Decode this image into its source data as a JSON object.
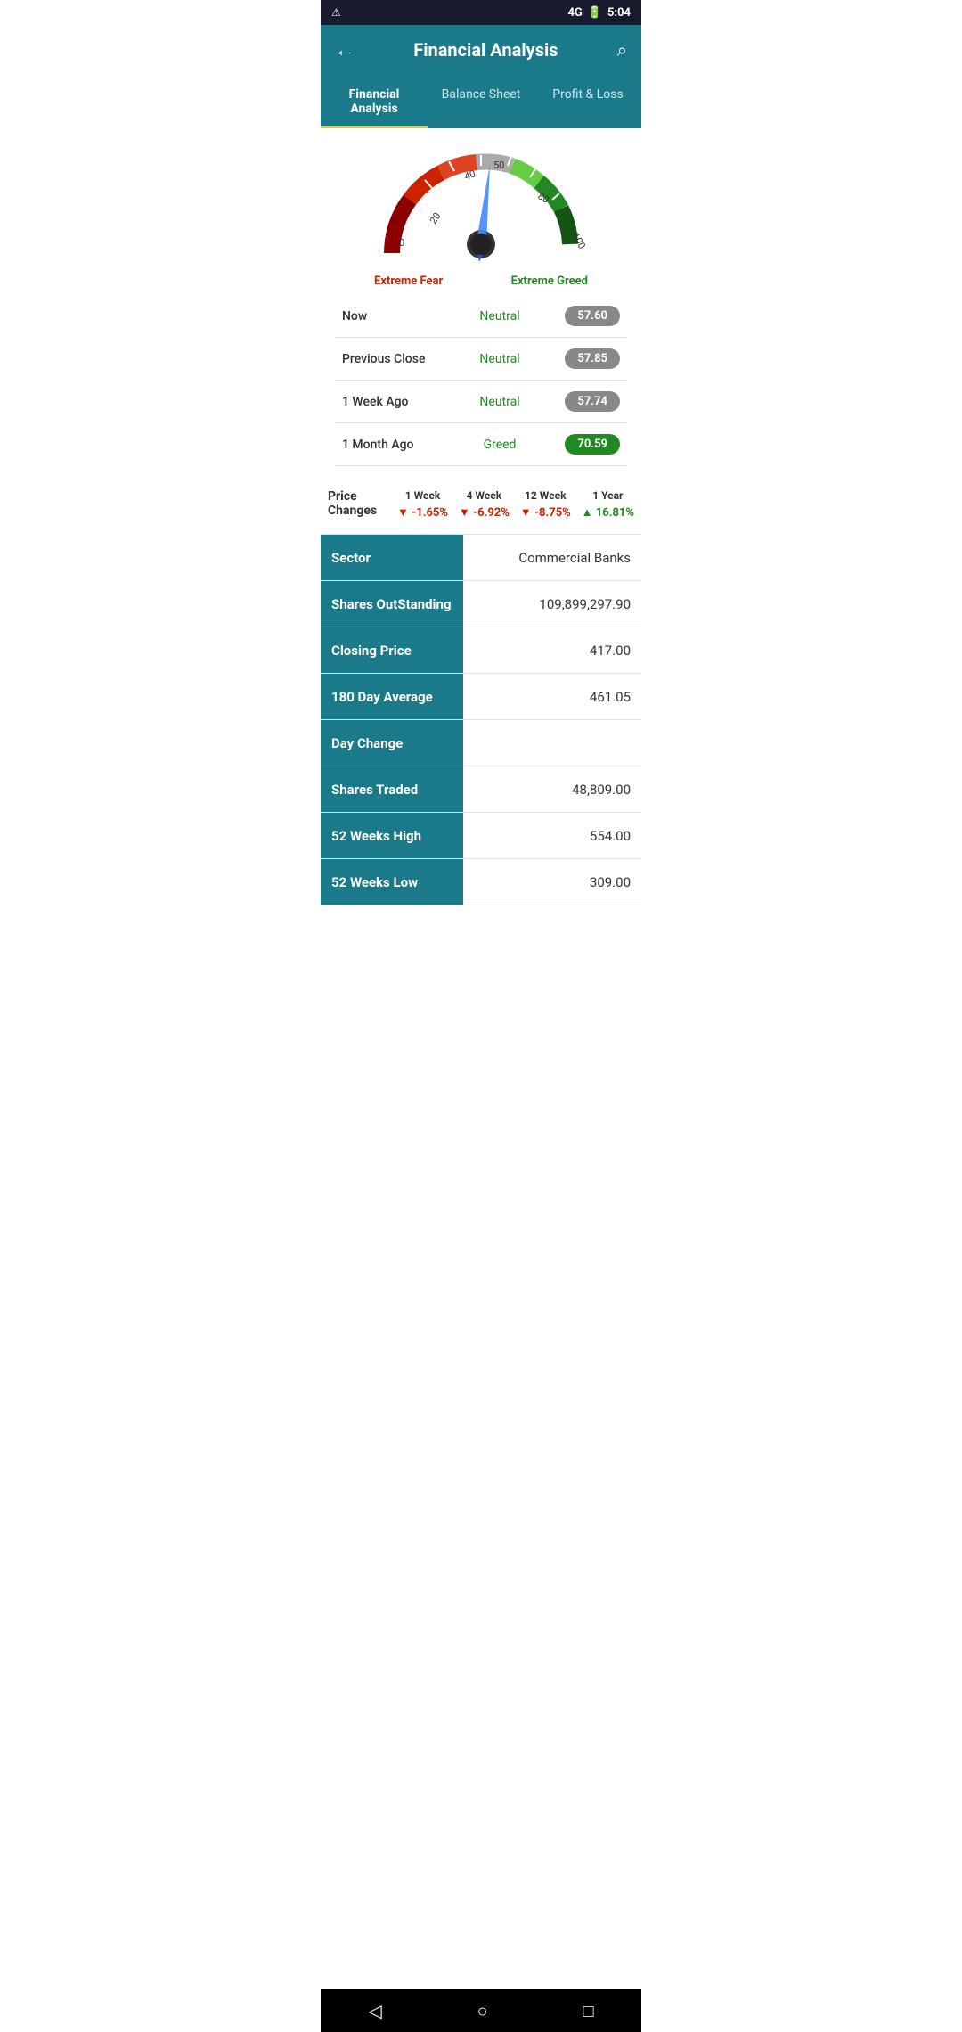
{
  "statusBar": {
    "leftIcon": "⚠",
    "signal": "4G",
    "battery": "⚡",
    "time": "5:04"
  },
  "header": {
    "backIcon": "←",
    "title": "Financial Analysis",
    "searchIcon": "🔍"
  },
  "tabs": [
    {
      "id": "financial-analysis",
      "label": "Financial Analysis",
      "active": true
    },
    {
      "id": "balance-sheet",
      "label": "Balance Sheet",
      "active": false
    },
    {
      "id": "profit-loss",
      "label": "Profit & Loss",
      "active": false
    }
  ],
  "gauge": {
    "extremeFearLabel": "Extreme Fear",
    "extremeGreedLabel": "Extreme Greed"
  },
  "fearGreedRows": [
    {
      "period": "Now",
      "sentiment": "Neutral",
      "value": "57.60",
      "green": false
    },
    {
      "period": "Previous Close",
      "sentiment": "Neutral",
      "value": "57.85",
      "green": false
    },
    {
      "period": "1 Week Ago",
      "sentiment": "Neutral",
      "value": "57.74",
      "green": false
    },
    {
      "period": "1 Month Ago",
      "sentiment": "Greed",
      "value": "70.59",
      "green": true
    }
  ],
  "priceChanges": {
    "label": "Price Changes",
    "columns": [
      {
        "period": "1 Week",
        "value": "-1.65%",
        "up": false
      },
      {
        "period": "4 Week",
        "value": "-6.92%",
        "up": false
      },
      {
        "period": "12 Week",
        "value": "-8.75%",
        "up": false
      },
      {
        "period": "1 Year",
        "value": "16.81%",
        "up": true
      }
    ]
  },
  "infoRows": [
    {
      "label": "Sector",
      "value": "Commercial Banks"
    },
    {
      "label": "Shares OutStanding",
      "value": "109,899,297.90"
    },
    {
      "label": "Closing Price",
      "value": "417.00"
    },
    {
      "label": "180 Day Average",
      "value": "461.05"
    },
    {
      "label": "Day Change",
      "value": ""
    },
    {
      "label": "Shares Traded",
      "value": "48,809.00"
    },
    {
      "label": "52 Weeks High",
      "value": "554.00"
    },
    {
      "label": "52 Weeks Low",
      "value": "309.00"
    }
  ],
  "bottomNav": {
    "backIcon": "◁",
    "homeIcon": "○",
    "recentIcon": "□"
  }
}
